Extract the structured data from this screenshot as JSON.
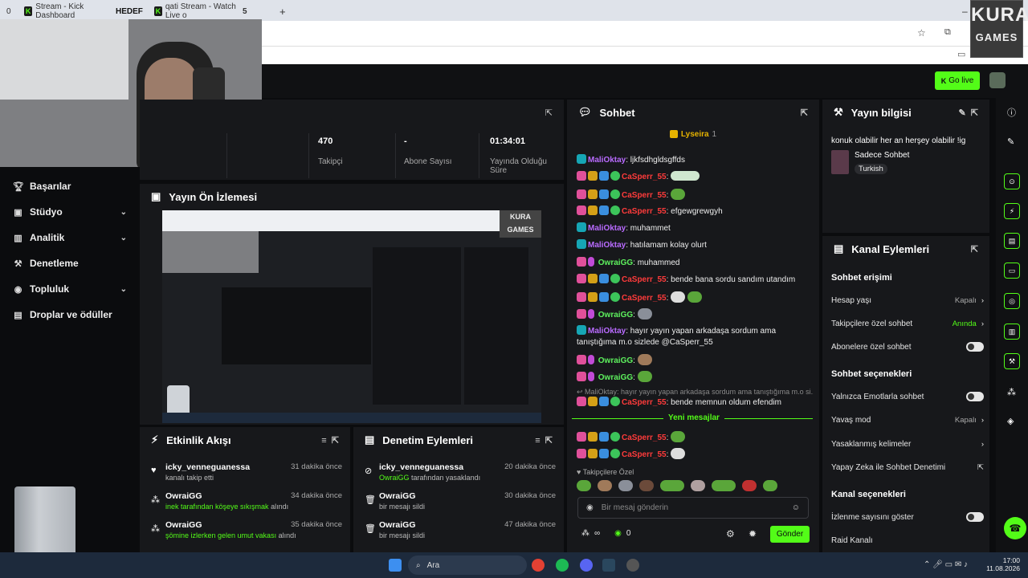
{
  "browser": {
    "tabs": [
      {
        "label": "Stream - Kick Dashboard"
      },
      {
        "label": "HEDEF"
      },
      {
        "label": "qati Stream - Watch Live o"
      }
    ],
    "tab_count_left": "0",
    "tab_count_right": "5",
    "new_tab": "+"
  },
  "watermark": {
    "line1": "KURA",
    "line2": "GAMES"
  },
  "header": {
    "go_live_label": "Go live"
  },
  "sidebar": {
    "items": [
      {
        "label": "Başarılar",
        "icon": "trophy-icon",
        "chevron": false
      },
      {
        "label": "Stüdyo",
        "icon": "studio-icon",
        "chevron": true
      },
      {
        "label": "Analitik",
        "icon": "chart-icon",
        "chevron": true
      },
      {
        "label": "Denetleme",
        "icon": "wrench-icon",
        "chevron": false
      },
      {
        "label": "Topluluk",
        "icon": "community-icon",
        "chevron": true
      },
      {
        "label": "Droplar ve ödüller",
        "icon": "drops-icon",
        "chevron": false
      }
    ]
  },
  "stats": [
    {
      "value": "470",
      "label": "Takipçi"
    },
    {
      "value": "-",
      "label": "Abone Sayısı"
    },
    {
      "value": "01:34:01",
      "label": "Yayında Olduğu Süre"
    }
  ],
  "preview": {
    "title": "Yayın Ön İzlemesi"
  },
  "activity": {
    "title": "Etkinlik Akışı",
    "items": [
      {
        "name": "icky_venneguanessa",
        "time": "31 dakika önce",
        "desc": "kanalı takip etti",
        "highlight": "",
        "icon": "heart-icon"
      },
      {
        "name": "OwraiGG",
        "time": "34 dakika önce",
        "highlight": "inek tarafından köşeye sıkışmak",
        "desc": " alındı",
        "icon": "reward-icon"
      },
      {
        "name": "OwraiGG",
        "time": "35 dakika önce",
        "highlight": "şömine izlerken gelen umut vakası",
        "desc": " alındı",
        "icon": "reward-icon"
      }
    ]
  },
  "moderation": {
    "title": "Denetim Eylemleri",
    "items": [
      {
        "name": "icky_venneguanessa",
        "time": "20 dakika önce",
        "highlight": "OwraiGG",
        "desc": " tarafından yasaklandı",
        "icon": "ban-icon"
      },
      {
        "name": "OwraiGG",
        "time": "30 dakika önce",
        "highlight": "",
        "desc": "bir mesajı sildi",
        "icon": "trash-icon"
      },
      {
        "name": "OwraiGG",
        "time": "47 dakika önce",
        "highlight": "",
        "desc": "bir mesajı sildi",
        "icon": "trash-icon"
      }
    ]
  },
  "chat": {
    "title": "Sohbet",
    "pinned_user": "Lyseira",
    "pinned_count": "1",
    "messages": [
      {
        "user": "MaliOktay",
        "text": ": ljkfsdhgldsgffds"
      },
      {
        "user": "CaSperr_55",
        "text": ":"
      },
      {
        "user": "CaSperr_55",
        "text": ":"
      },
      {
        "user": "CaSperr_55",
        "text": ": efgewgrewgyh"
      },
      {
        "user": "MaliOktay",
        "text": ": muhammet"
      },
      {
        "user": "MaliOktay",
        "text": ": hatılamam kolay olurt"
      },
      {
        "user": "OwraiGG",
        "text": ": muhammed"
      },
      {
        "user": "CaSperr_55",
        "text": ": bende bana sordu sandım utandım"
      },
      {
        "user": "CaSperr_55",
        "text": ":"
      },
      {
        "user": "OwraiGG",
        "text": ":"
      },
      {
        "user": "MaliOktay",
        "text": ": hayır yayın yapan arkadaşa sordum ama tanıştığıma m.o sizlede @CaSperr_55"
      },
      {
        "user": "OwraiGG",
        "text": ":"
      },
      {
        "user": "OwraiGG",
        "text": ":"
      },
      {
        "user": "CaSperr_55",
        "text": ": bende memnun oldum efendim"
      },
      {
        "user": "CaSperr_55",
        "text": ":"
      },
      {
        "user": "CaSperr_55",
        "text": ":"
      }
    ],
    "reply_preview": "MaliOktay: hayır yayın yapan arkadaşa sordum ama tanıştığıma m.o si...",
    "new_messages_label": "Yeni mesajlar",
    "followers_only_label": "Takipçilere Özel",
    "input_placeholder": "Bir mesaj gönderin",
    "points": "∞",
    "kick_count": "0",
    "send_label": "Gönder"
  },
  "stream_info": {
    "title": "Yayın bilgisi",
    "stream_title": "konuk olabilir her an herşey olabilir !ig",
    "category": "Sadece Sohbet",
    "tag": "Turkish"
  },
  "channel_actions": {
    "title": "Kanal Eylemleri",
    "section1": "Sohbet erişimi",
    "slow_mode_label": "Hesap yaşı",
    "slow_mode_value": "Kapalı",
    "followers_only_label": "Takipçilere özel sohbet",
    "followers_only_value": "Anında",
    "subs_only_label": "Abonelere özel sohbet",
    "section2": "Sohbet seçenekleri",
    "emote_only_label": "Yalnızca Emotlarla sohbet",
    "slow_label": "Yavaş mod",
    "slow_value": "Kapalı",
    "banned_words_label": "Yasaklanmış kelimeler",
    "ai_mod_label": "Yapay Zeka ile Sohbet Denetimi",
    "section3": "Kanal seçenekleri",
    "viewer_count_label": "İzlenme sayısını göster",
    "raid_label": "Raid Kanalı"
  },
  "taskbar": {
    "search_label": "Ara",
    "time": "17:00",
    "date": "11.08.2026"
  },
  "colors": {
    "accent": "#53fc18",
    "panel": "#17181b",
    "bg": "#0b0c0e"
  }
}
